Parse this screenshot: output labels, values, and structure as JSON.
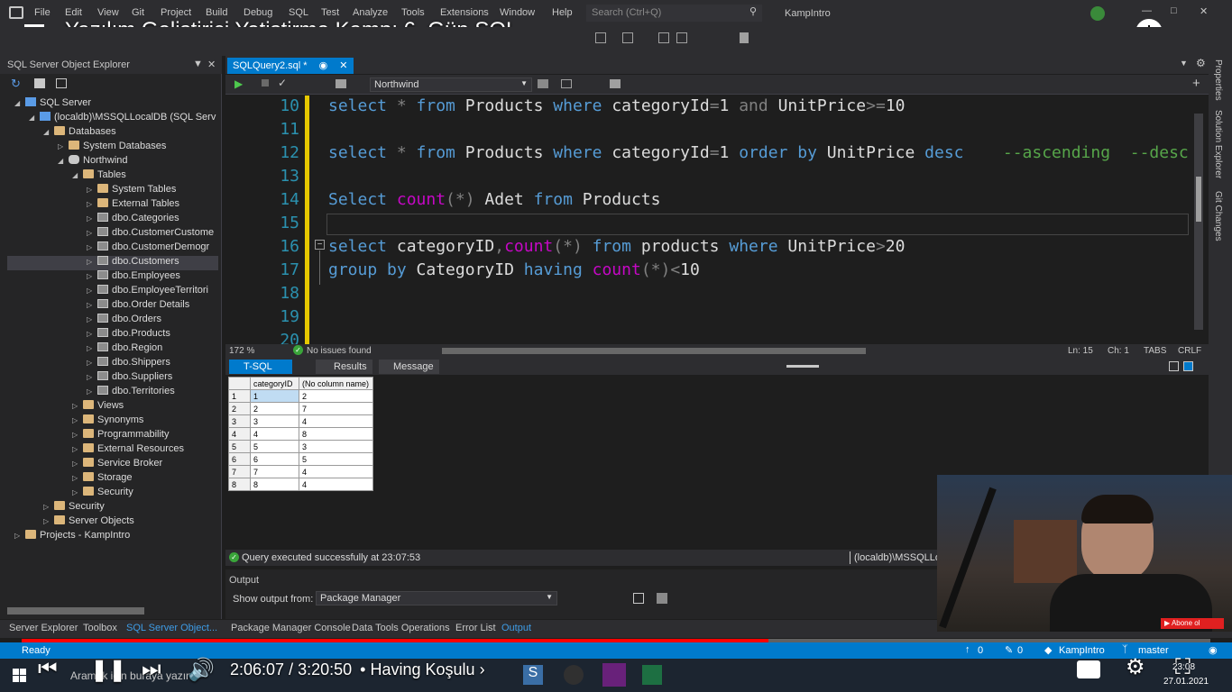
{
  "video": {
    "title": "Yazılım Geliştirici Yetiştirme Kampı 6. Gün SQL",
    "time_current": "2:06:07",
    "time_total": "3:20:50",
    "chapter": "• Having Koşulu",
    "progress_fraction": 0.628,
    "subscribe_label": "Abone ol"
  },
  "menubar": {
    "items": [
      "File",
      "Edit",
      "View",
      "Git",
      "Project",
      "Build",
      "Debug",
      "SQL",
      "Test",
      "Analyze",
      "Tools",
      "Extensions",
      "Window",
      "Help"
    ],
    "search_placeholder": "Search (Ctrl+Q)",
    "solution_name": "KampIntro"
  },
  "object_explorer": {
    "title": "SQL Server Object Explorer",
    "rows": [
      {
        "label": "SQL Server",
        "icon": "server-icon",
        "expanded": true,
        "indent": 0
      },
      {
        "label": "(localdb)\\MSSQLLocalDB (SQL Serv",
        "icon": "server-icon",
        "expanded": true,
        "indent": 1
      },
      {
        "label": "Databases",
        "icon": "folder-icon",
        "expanded": true,
        "indent": 2
      },
      {
        "label": "System Databases",
        "icon": "folder-icon",
        "expanded": false,
        "indent": 3
      },
      {
        "label": "Northwind",
        "icon": "database-icon",
        "expanded": true,
        "indent": 3
      },
      {
        "label": "Tables",
        "icon": "folder-icon",
        "expanded": true,
        "indent": 4
      },
      {
        "label": "System Tables",
        "icon": "folder-icon",
        "expanded": false,
        "indent": 5
      },
      {
        "label": "External Tables",
        "icon": "folder-icon",
        "expanded": false,
        "indent": 5
      },
      {
        "label": "dbo.Categories",
        "icon": "table-icon",
        "expanded": false,
        "indent": 5
      },
      {
        "label": "dbo.CustomerCustome",
        "icon": "table-icon",
        "expanded": false,
        "indent": 5
      },
      {
        "label": "dbo.CustomerDemogr",
        "icon": "table-icon",
        "expanded": false,
        "indent": 5
      },
      {
        "label": "dbo.Customers",
        "icon": "table-icon",
        "expanded": false,
        "indent": 5,
        "selected": true
      },
      {
        "label": "dbo.Employees",
        "icon": "table-icon",
        "expanded": false,
        "indent": 5
      },
      {
        "label": "dbo.EmployeeTerritori",
        "icon": "table-icon",
        "expanded": false,
        "indent": 5
      },
      {
        "label": "dbo.Order Details",
        "icon": "table-icon",
        "expanded": false,
        "indent": 5
      },
      {
        "label": "dbo.Orders",
        "icon": "table-icon",
        "expanded": false,
        "indent": 5
      },
      {
        "label": "dbo.Products",
        "icon": "table-icon",
        "expanded": false,
        "indent": 5
      },
      {
        "label": "dbo.Region",
        "icon": "table-icon",
        "expanded": false,
        "indent": 5
      },
      {
        "label": "dbo.Shippers",
        "icon": "table-icon",
        "expanded": false,
        "indent": 5
      },
      {
        "label": "dbo.Suppliers",
        "icon": "table-icon",
        "expanded": false,
        "indent": 5
      },
      {
        "label": "dbo.Territories",
        "icon": "table-icon",
        "expanded": false,
        "indent": 5
      },
      {
        "label": "Views",
        "icon": "folder-icon",
        "expanded": false,
        "indent": 4
      },
      {
        "label": "Synonyms",
        "icon": "folder-icon",
        "expanded": false,
        "indent": 4
      },
      {
        "label": "Programmability",
        "icon": "folder-icon",
        "expanded": false,
        "indent": 4
      },
      {
        "label": "External Resources",
        "icon": "folder-icon",
        "expanded": false,
        "indent": 4
      },
      {
        "label": "Service Broker",
        "icon": "folder-icon",
        "expanded": false,
        "indent": 4
      },
      {
        "label": "Storage",
        "icon": "folder-icon",
        "expanded": false,
        "indent": 4
      },
      {
        "label": "Security",
        "icon": "folder-icon",
        "expanded": false,
        "indent": 4
      },
      {
        "label": "Security",
        "icon": "folder-icon",
        "expanded": false,
        "indent": 2
      },
      {
        "label": "Server Objects",
        "icon": "folder-icon",
        "expanded": false,
        "indent": 2
      },
      {
        "label": "Projects - KampIntro",
        "icon": "folder-icon",
        "expanded": false,
        "indent": 0
      }
    ]
  },
  "editor": {
    "tab_label": "SQLQuery2.sql *",
    "database": "Northwind",
    "zoom": "172 %",
    "issues": "No issues found",
    "position": {
      "ln": "Ln: 15",
      "ch": "Ch: 1",
      "mode": "TABS",
      "eol": "CRLF"
    },
    "lines": [
      {
        "n": "10",
        "tokens": [
          [
            "kw",
            "select "
          ],
          [
            "gr",
            "* "
          ],
          [
            "kw",
            "from "
          ],
          [
            "",
            "Products "
          ],
          [
            "kw",
            "where "
          ],
          [
            "",
            "categoryId"
          ],
          [
            "gr",
            "="
          ],
          [
            "",
            "1 "
          ],
          [
            "gr",
            "and "
          ],
          [
            "",
            "UnitPrice"
          ],
          [
            "gr",
            ">="
          ],
          [
            "",
            "10"
          ]
        ]
      },
      {
        "n": "11",
        "tokens": []
      },
      {
        "n": "12",
        "tokens": [
          [
            "kw",
            "select "
          ],
          [
            "gr",
            "* "
          ],
          [
            "kw",
            "from "
          ],
          [
            "",
            "Products "
          ],
          [
            "kw",
            "where "
          ],
          [
            "",
            "categoryId"
          ],
          [
            "gr",
            "="
          ],
          [
            "",
            "1 "
          ],
          [
            "kw",
            "order by "
          ],
          [
            "",
            "UnitPrice "
          ],
          [
            "kw",
            "desc"
          ],
          [
            "",
            "    "
          ],
          [
            "cm",
            "--ascending  --desc"
          ]
        ]
      },
      {
        "n": "13",
        "tokens": []
      },
      {
        "n": "14",
        "tokens": [
          [
            "kw",
            "Select "
          ],
          [
            "fn",
            "count"
          ],
          [
            "gr",
            "(*) "
          ],
          [
            "",
            "Adet "
          ],
          [
            "kw",
            "from "
          ],
          [
            "",
            "Products"
          ]
        ]
      },
      {
        "n": "15",
        "tokens": []
      },
      {
        "n": "16",
        "tokens": [
          [
            "kw",
            "select "
          ],
          [
            "",
            "categoryID"
          ],
          [
            "gr",
            ","
          ],
          [
            "fn",
            "count"
          ],
          [
            "gr",
            "(*) "
          ],
          [
            "kw",
            "from "
          ],
          [
            "",
            "products "
          ],
          [
            "kw",
            "where "
          ],
          [
            "",
            "UnitPrice"
          ],
          [
            "gr",
            ">"
          ],
          [
            "",
            "20"
          ]
        ]
      },
      {
        "n": "17",
        "tokens": [
          [
            "kw",
            "group by "
          ],
          [
            "",
            "CategoryID "
          ],
          [
            "kw",
            "having "
          ],
          [
            "fn",
            "count"
          ],
          [
            "gr",
            "(*)<"
          ],
          [
            "",
            "10"
          ]
        ]
      },
      {
        "n": "18",
        "tokens": []
      },
      {
        "n": "19",
        "tokens": []
      },
      {
        "n": "20",
        "tokens": []
      }
    ]
  },
  "results": {
    "tabs": [
      "T-SQL",
      "Results",
      "Message"
    ],
    "columns": [
      "categoryID",
      "(No column name)"
    ],
    "rows": [
      [
        "1",
        "2"
      ],
      [
        "2",
        "7"
      ],
      [
        "3",
        "4"
      ],
      [
        "4",
        "8"
      ],
      [
        "5",
        "3"
      ],
      [
        "6",
        "5"
      ],
      [
        "7",
        "4"
      ],
      [
        "8",
        "4"
      ]
    ],
    "status": "Query executed successfully at 23:07:53",
    "connection": "(localdb)\\MSSQLLoc"
  },
  "output": {
    "title": "Output",
    "show_from_label": "Show output from:",
    "source": "Package Manager"
  },
  "bottom_tabs": {
    "left": [
      "Server Explorer",
      "Toolbox",
      "SQL Server Object..."
    ],
    "right": [
      "Package Manager Console",
      "Data Tools Operations",
      "Error List",
      "Output"
    ]
  },
  "statusbar": {
    "ready": "Ready",
    "up": "0",
    "pencil": "0",
    "repo": "KampIntro",
    "branch": "master"
  },
  "side_panels": [
    "Properties",
    "Solution Explorer",
    "Git Changes"
  ],
  "taskbar": {
    "search_placeholder": "Aramak için buraya yazın",
    "time": "23:08",
    "date": "27.01.2021"
  }
}
